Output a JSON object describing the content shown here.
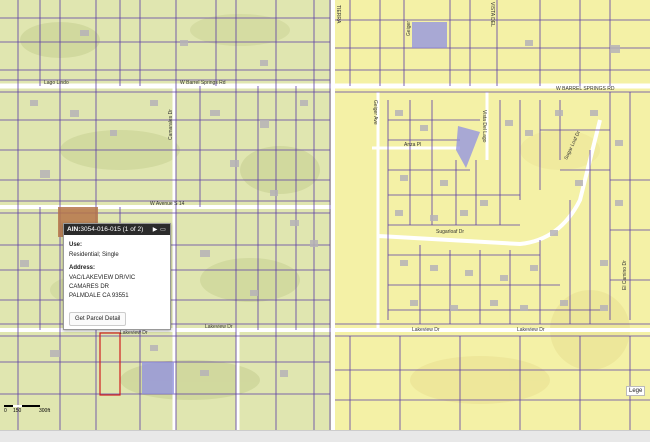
{
  "map": {
    "roads": {
      "w_barrel_springs_rd_left": "W Barrel Springs Rd",
      "w_barrel_springs_rd_right": "W BARREL SPRINGS RD",
      "lago_lindo": "Lago Lindo",
      "w_avenue_s14": "W Avenue S 14",
      "sugarloaf_dr": "Sugarloaf Dr",
      "lakeview_dr_left": "Lakeview Dr",
      "lakeview_dr_mid": "Lakeview Dr",
      "lakeview_dr_right": "Lakeview Dr",
      "anza_pl": "Anza Pl",
      "geiger_ave": "Geiger Ave",
      "vista_del_lago": "Vista Del Lago",
      "sugar_loaf_dr_v": "Sugar Loaf Dr",
      "el_camino_dr": "El Camino Dr",
      "tierra": "TIERRA",
      "camarales_dr": "Camarales Dr",
      "geiger_top": "Geiger",
      "vista_top": "VISTA DEL"
    },
    "colors": {
      "parcel_line": "#5b3ca6",
      "road": "#ffffff",
      "selected_parcel": "#d11f1f",
      "highlight_parcel": "#7f7fd9",
      "terrain_left": "#e4e8b8",
      "terrain_right": "#f4f1a8",
      "brown_parcel": "#b5744a"
    }
  },
  "popup": {
    "ain_label": "AIN:",
    "ain_value": "3054-016-015 (1 of 2)",
    "next_icon": "play-icon",
    "close_icon": "window-icon",
    "use_label": "Use:",
    "use_value": "Residential; Single",
    "address_label": "Address:",
    "address_line1": "VAC/LAKEVIEW DR/VIC CAMARES DR",
    "address_line2": "PALMDALE CA 93551",
    "button_label": "Get Parcel Detail"
  },
  "scalebar": {
    "t0": "0",
    "t1": "150",
    "t2": "300ft"
  },
  "legend": {
    "label": "Lege"
  }
}
